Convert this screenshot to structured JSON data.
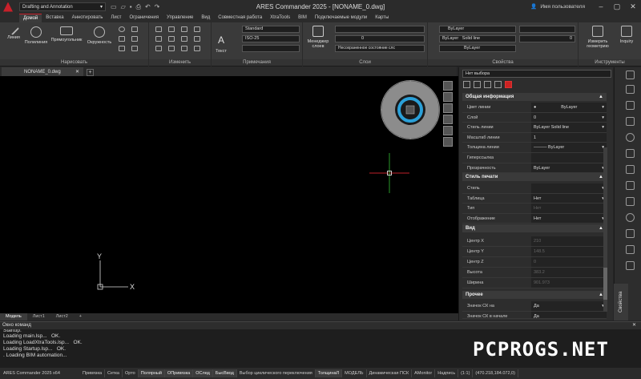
{
  "app": {
    "title": "ARES Commander 2025 - [NONAME_0.dwg]",
    "workspace": "Drafting and Annotation",
    "user": "Имя пользователя"
  },
  "menu_tabs": [
    "Домой",
    "Вставка",
    "Аннотировать",
    "Лист",
    "Ограничения",
    "Управление",
    "Вид",
    "Совместная работа",
    "XtraTools",
    "BIM",
    "Подключаемые модули",
    "Карты"
  ],
  "ribbon": {
    "draw": {
      "tools": [
        "Линия",
        "Полилиния",
        "Прямоугольник",
        "Окружность"
      ],
      "label": "Нарисовать"
    },
    "modify": {
      "label": "Изменить"
    },
    "annotation": {
      "text": "Текст",
      "text_style": "Standard",
      "dim_style": "ISO-25",
      "label": "Примечания"
    },
    "layers": {
      "manager": "Менеджер слоев",
      "layer": "0",
      "state": "Несохраненное состояние слс",
      "label": "Слои"
    },
    "properties": {
      "color": "ByLayer",
      "linetype": "ByLayer",
      "linetype_name": "Solid line",
      "lineweight": "ByLayer",
      "label": "Свойства",
      "transparency": "0"
    },
    "tools": {
      "measure": "Измерить геометрию",
      "inquiry": "Inquiry",
      "label": "Инструменты"
    }
  },
  "doc_tab": "NONAME_0.dwg",
  "layout_tabs": [
    "Модель",
    "Лист1",
    "Лист2"
  ],
  "properties_panel": {
    "selection": "Нет выбора",
    "sections": [
      {
        "title": "Общая информация",
        "rows": [
          {
            "k": "Цвет линии",
            "v": "ByLayer"
          },
          {
            "k": "Слой",
            "v": "0"
          },
          {
            "k": "Стиль линии",
            "v": "ByLayer     Solid line"
          },
          {
            "k": "Масштаб линии",
            "v": "1"
          },
          {
            "k": "Толщина линии",
            "v": "——— ByLayer"
          },
          {
            "k": "Гиперссылка",
            "v": ""
          },
          {
            "k": "Прозрачность",
            "v": "ByLayer"
          }
        ]
      },
      {
        "title": "Стиль печати",
        "rows": [
          {
            "k": "Стиль",
            "v": ""
          },
          {
            "k": "Таблица",
            "v": "Нет"
          },
          {
            "k": "Тип",
            "v": "Нет"
          },
          {
            "k": "Отображение",
            "v": "Нет"
          }
        ]
      },
      {
        "title": "Вид",
        "rows": [
          {
            "k": "Центр X",
            "v": "210"
          },
          {
            "k": "Центр Y",
            "v": "148.5"
          },
          {
            "k": "Центр Z",
            "v": "0"
          },
          {
            "k": "Высота",
            "v": "383.2"
          },
          {
            "k": "Ширина",
            "v": "901.973"
          }
        ]
      },
      {
        "title": "Прочее",
        "rows": [
          {
            "k": "Значок СК на",
            "v": "Да"
          },
          {
            "k": "Значок СК в начале",
            "v": "Да"
          }
        ]
      }
    ],
    "vertical_tab": "Свойства"
  },
  "command_window": {
    "title": "Окно команд",
    "lines": [
      "Startup.",
      "Loading main.lsp...   OK.",
      "Loading LoadXtraTools.lsp...   OK.",
      "Loading Startup.lsp...   OK.",
      ". Loading BIM automation..."
    ]
  },
  "status_bar": {
    "product": "ARES Commander 2025 x64",
    "toggles": [
      "Привязка",
      "Сетка",
      "Орто",
      "Полярный",
      "ОПривязка",
      "ОСлед",
      "БысВвод",
      "Выбор циклического переключения",
      "ТолщинаЛ",
      "МОДЕЛЬ",
      "Динамическая ПСК",
      "AMonitor",
      "Надпись",
      "(1:1)",
      "(470.218,184.072,0)"
    ]
  },
  "watermark": "PCPROGS.NET"
}
